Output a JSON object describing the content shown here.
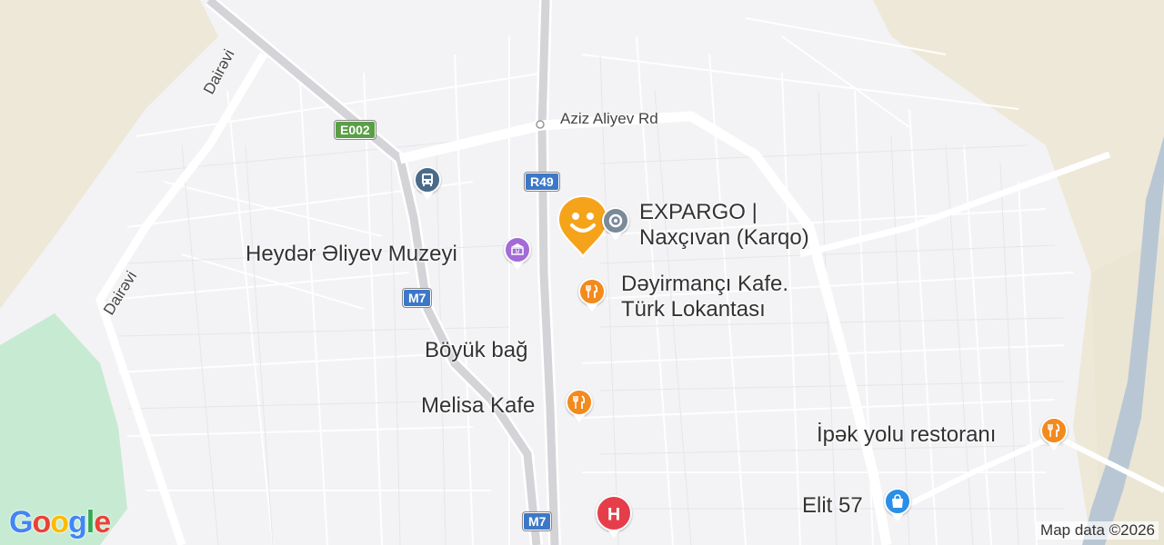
{
  "map": {
    "places": [
      {
        "name": "Heydər Əliyev Muzeyi",
        "icon": "museum-icon",
        "color": "#a36bd7"
      },
      {
        "name": "EXPARGO | Naxçıvan (Karqo)",
        "line1": "EXPARGO |",
        "line2": "Naxçıvan (Karqo)",
        "icon": "cargo-icon",
        "color": "#7a8a99"
      },
      {
        "name": "Dəyirmançı Kafe. Türk Lokantası",
        "line1": "Dəyirmançı Kafe.",
        "line2": "Türk Lokantası",
        "icon": "fork-knife-icon",
        "color": "#f28a1e"
      },
      {
        "name": "Melisa Kafe",
        "icon": "fork-knife-icon",
        "color": "#f28a1e"
      },
      {
        "name": "İpək yolu restoranı",
        "icon": "fork-knife-icon",
        "color": "#f28a1e"
      },
      {
        "name": "Elit 57",
        "icon": "shopping-bag-icon",
        "color": "#2a8fe6"
      },
      {
        "name": "Hospital",
        "icon": "hospital-icon",
        "color": "#e53e4a"
      },
      {
        "name": "Bus station",
        "icon": "bus-icon",
        "color": "#4a6a8a"
      }
    ],
    "areas": [
      "Böyük bağ"
    ],
    "streets": [
      "Aziz Aliyev Rd",
      "Dairəvi",
      "Dairəvi"
    ],
    "route_shields": [
      {
        "label": "E002",
        "color": "#5a9e46"
      },
      {
        "label": "R49",
        "color": "#3c78c8"
      },
      {
        "label": "M7",
        "color": "#3c78c8"
      },
      {
        "label": "M7",
        "color": "#3c78c8"
      }
    ],
    "pegman_marker": {
      "icon": "smiley-marker-icon",
      "color": "#f5a31a"
    }
  },
  "branding": {
    "logo": "Google",
    "attribution": "Map data ©2026"
  }
}
